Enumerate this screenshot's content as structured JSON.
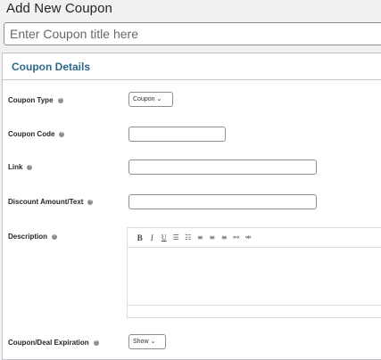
{
  "page": {
    "title": "Add New Coupon"
  },
  "title_input": {
    "placeholder": "Enter Coupon title here"
  },
  "panel": {
    "title": "Coupon Details"
  },
  "fields": {
    "coupon_type": {
      "label": "Coupon Type",
      "value": "Coupon"
    },
    "coupon_code": {
      "label": "Coupon Code",
      "value": ""
    },
    "link": {
      "label": "Link",
      "value": ""
    },
    "discount": {
      "label": "Discount Amount/Text",
      "value": ""
    },
    "description": {
      "label": "Description"
    },
    "expiration": {
      "label": "Coupon/Deal Expiration",
      "value": "Show"
    }
  },
  "editor_toolbar": [
    {
      "icon": "bold-icon",
      "glyph": "B"
    },
    {
      "icon": "italic-icon",
      "glyph": "I"
    },
    {
      "icon": "underline-icon",
      "glyph": "U"
    },
    {
      "icon": "bullet-list-icon",
      "glyph": "☰"
    },
    {
      "icon": "numbered-list-icon",
      "glyph": "☷"
    },
    {
      "icon": "align-left-icon",
      "glyph": "≡"
    },
    {
      "icon": "align-center-icon",
      "glyph": "≡"
    },
    {
      "icon": "align-right-icon",
      "glyph": "≡"
    },
    {
      "icon": "link-icon",
      "glyph": "⚯"
    },
    {
      "icon": "unlink-icon",
      "glyph": "⚮"
    }
  ],
  "colors": {
    "accent": "#2c6a8a",
    "border": "#8c8f94",
    "background": "#f1f1f1"
  }
}
